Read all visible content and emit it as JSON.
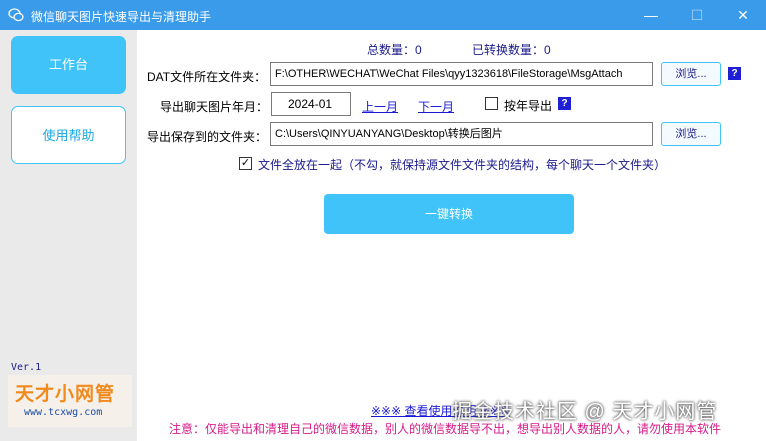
{
  "window": {
    "title": "微信聊天图片快速导出与清理助手",
    "minimize": "—",
    "maximize": "☐",
    "close": "✕"
  },
  "sidebar": {
    "items": [
      {
        "label": "工作台",
        "active": true
      },
      {
        "label": "使用帮助",
        "active": false
      }
    ],
    "version": "Ver.1",
    "logo": {
      "text": "天才小网管",
      "url": "www.tcxwg.com"
    }
  },
  "stats": {
    "total_label": "总数量：0",
    "converted_label": "已转换数量：0"
  },
  "dat_folder": {
    "label": "DAT文件所在文件夹：",
    "value": "F:\\OTHER\\WECHAT\\WeChat Files\\qyy1323618\\FileStorage\\MsgAttach",
    "browse_label": "浏览...",
    "help": "?"
  },
  "month": {
    "label": "导出聊天图片年月：",
    "value": "2024-01",
    "prev_label": "上一月",
    "next_label": "下一月",
    "by_year_label": "按年导出",
    "by_year_checked": false,
    "help": "?"
  },
  "save_folder": {
    "label": "导出保存到的文件夹：",
    "value": "C:\\Users\\QINYUANYANG\\Desktop\\转换后图片",
    "browse_label": "浏览..."
  },
  "together": {
    "checked": true,
    "check_mark": "✓",
    "label": "文件全放在一起（不勾，就保持源文件文件夹的结构，每个聊天一个文件夹）"
  },
  "convert_button": "一键转换",
  "bottom": {
    "link": "※※※ 查看使用说明 ※※※",
    "warning": "注意：仅能导出和清理自己的微信数据，别人的微信数据导不出，想导出别人数据的人，请勿使用本软件"
  },
  "watermark": "掘金技术社区 @ 天才小网管",
  "colors": {
    "titlebar": "#3a9bea",
    "accent": "#3fc3f8",
    "link": "#1a1ad6",
    "warning": "#d61a8a"
  },
  "icons": {
    "app": "wechat-icon"
  }
}
